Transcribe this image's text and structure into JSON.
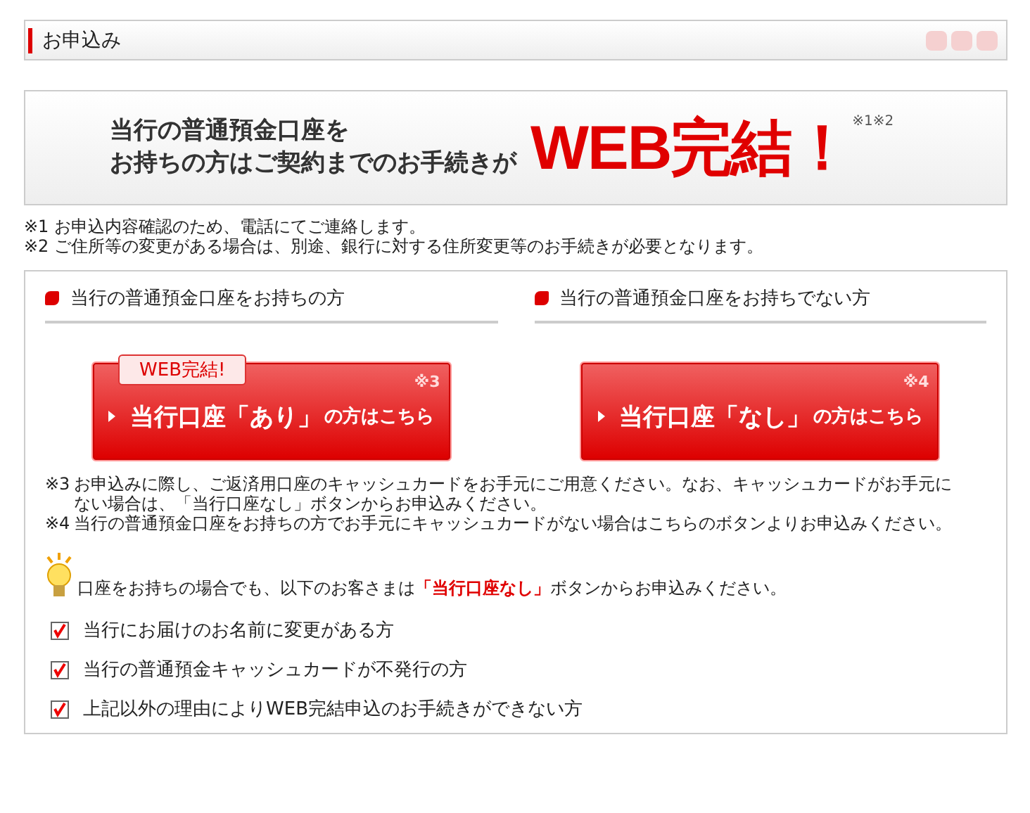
{
  "header": {
    "title": "お申込み"
  },
  "banner": {
    "lines": [
      "当行の普通預金口座を",
      "お持ちの方はご契約までのお手続きが"
    ],
    "headline": "WEB完結！",
    "marks": "※1※2"
  },
  "notes": [
    {
      "mark": "※1",
      "text": "お申込内容確認のため、電話にてご連絡します。"
    },
    {
      "mark": "※2",
      "text": "ご住所等の変更がある場合は、別途、銀行に対する住所変更等のお手続きが必要となります。"
    }
  ],
  "columns": [
    {
      "heading": "当行の普通預金口座をお持ちの方",
      "badge": "WEB完結!",
      "button": {
        "before": "当行口座",
        "quoted": "「あり」",
        "after": "の方はこちら",
        "mark": "※3"
      }
    },
    {
      "heading": "当行の普通預金口座をお持ちでない方",
      "button": {
        "before": "当行口座",
        "quoted": "「なし」",
        "after": "の方はこちら",
        "mark": "※4"
      }
    }
  ],
  "button_notes": [
    {
      "mark": "※3",
      "text": "お申込みに際し、ご返済用口座のキャッシュカードをお手元にご用意ください。なお、キャッシュカードがお手元にない場合は、「当行口座なし」ボタンからお申込みください。"
    },
    {
      "mark": "※4",
      "text": "当行の普通預金口座をお持ちの方でお手元にキャッシュカードがない場合はこちらのボタンよりお申込みください。"
    }
  ],
  "tip": "口座をお持ちの場合でも、以下のお客さまは**「当行口座なし」**ボタンからお申込みください。",
  "conditions": [
    "当行にお届けのお名前に変更がある方",
    "当行の普通預金キャッシュカードが不発行の方",
    "上記以外の理由によりWEB完結申込のお手続きができない方"
  ]
}
